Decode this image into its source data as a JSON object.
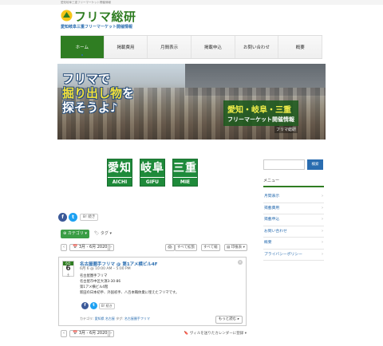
{
  "header": {
    "tagline": "愛知岐阜三重フリーマーケット開催情報",
    "logo_title": "フリマ総研",
    "logo_subtitle": "愛知岐阜三重フリーマーケット開催情報"
  },
  "nav": {
    "items": [
      {
        "label": "ホーム",
        "active": true
      },
      {
        "label": "掲載費用",
        "active": false
      },
      {
        "label": "月間表示",
        "active": false
      },
      {
        "label": "掲載申込",
        "active": false
      },
      {
        "label": "お問い合わせ",
        "active": false
      },
      {
        "label": "概要",
        "active": false
      }
    ]
  },
  "hero": {
    "copy_line1": "フリマで",
    "copy_line2_hl": "掘り出し物",
    "copy_line2_rest": "を",
    "copy_line3": "探そうよ♪",
    "areas": "愛知・岐阜・三重",
    "info": "フリーマーケット開催情報",
    "site": "フリマ総研"
  },
  "prefectures": [
    {
      "kanji": "愛知",
      "roman": "AICHI"
    },
    {
      "kanji": "岐阜",
      "roman": "GIFU"
    },
    {
      "kanji": "三重",
      "roman": "MIE"
    }
  ],
  "share": {
    "facebook": "f",
    "twitter": "t",
    "hatena": "B! 続き"
  },
  "calendar": {
    "category_label": "⊕ カテゴリ ▾",
    "tag_label": "🏷 タグ ▾",
    "month": "📅 3月 - 6月 2020",
    "prev": "‹",
    "next": "›",
    "print": "🖨",
    "expand_all": "すべて拡張",
    "collapse_all": "すべて縮",
    "view": "▤ 印植表 ▾",
    "footer_month": "📅 3月 - 6月 2020",
    "gcal_label": "🔖 ヴィルを送りたカレンダーに登録 ▾"
  },
  "event": {
    "month": "6月",
    "day": "6",
    "weekday": "土",
    "title": "名古屋圏手フリマ @ 第1アメ横ビル4F",
    "time": "6月 6 @ 10:00 AM – 5:00 PM",
    "line1": "名古屋圏手フリマ",
    "line2": "名古屋市中区大須3-30-86",
    "line3": "第1アメ横ビル4階",
    "line4": "新田の日本初手、外国初手、八百本職体業に埋えたフリマです。",
    "more_label": "もっと読む ▸",
    "meta_category_label": "カテゴリ:",
    "meta_tags": [
      "愛知県",
      "名古屋"
    ],
    "meta_tag_label": "タグ:",
    "meta_tag_value": "名古屋圏手フリマ"
  },
  "sidebar": {
    "search_placeholder": "",
    "search_button": "検索",
    "menu_title": "メニュー",
    "menu_items": [
      "月間表示",
      "掲載費用",
      "掲載申込",
      "お問い合わせ",
      "概要",
      "プライバシーポリシー"
    ]
  },
  "colors": {
    "brand_green": "#2f7d22",
    "link_blue": "#2a6db0",
    "pref_green": "#1e8a3a"
  }
}
